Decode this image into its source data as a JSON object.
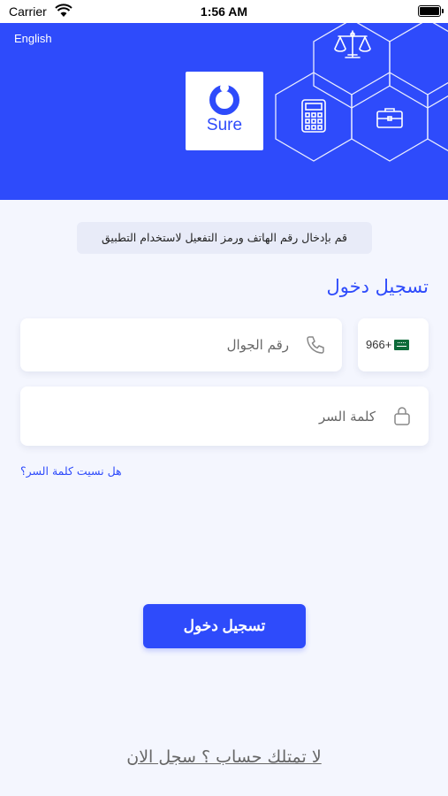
{
  "status_bar": {
    "carrier": "Carrier",
    "time": "1:56 AM"
  },
  "header": {
    "language_link": "English",
    "logo_text": "Sure",
    "hex_icons": [
      "scales-icon",
      "calculator-icon",
      "briefcase-icon"
    ]
  },
  "info_message": "قم بإدخال رقم الهاتف ورمز التفعيل لاستخدام التطبيق",
  "form": {
    "title": "تسجيل دخول",
    "country_code": "966+",
    "phone_placeholder": "رقم الجوال",
    "password_placeholder": "كلمة السر",
    "forgot_password": "هل نسيت كلمة السر؟",
    "login_button": "تسجيل دخول"
  },
  "register_link": "لا تمتلك حساب ؟ سجل الان",
  "colors": {
    "primary": "#2e4bfb",
    "background": "#f4f6fe",
    "field": "#ffffff"
  }
}
